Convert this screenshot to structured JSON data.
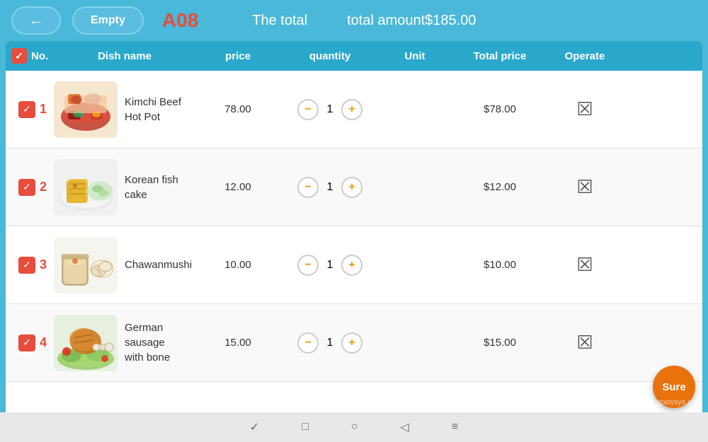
{
  "header": {
    "back_label": "←",
    "empty_label": "Empty",
    "table_id": "A08",
    "total_label": "The total",
    "total_amount": "total amount$185.00"
  },
  "table": {
    "columns": [
      "No.",
      "Dish name",
      "price",
      "quantity",
      "Unit",
      "Total price",
      "Operate"
    ],
    "rows": [
      {
        "id": 1,
        "name": "Kimchi Beef Hot Pot",
        "price": "78.00",
        "quantity": 1,
        "unit": "",
        "total_price": "$78.00",
        "color_scheme": "red-broth"
      },
      {
        "id": 2,
        "name": "Korean fish cake",
        "price": "12.00",
        "quantity": 1,
        "unit": "",
        "total_price": "$12.00",
        "color_scheme": "fish-cake"
      },
      {
        "id": 3,
        "name": "Chawanmushi",
        "price": "10.00",
        "quantity": 1,
        "unit": "",
        "total_price": "$10.00",
        "color_scheme": "chawanmushi"
      },
      {
        "id": 4,
        "name": "German sausage\nwith bone",
        "price": "15.00",
        "quantity": 1,
        "unit": "",
        "total_price": "$15.00",
        "color_scheme": "sausage"
      }
    ]
  },
  "sure_button": "Sure",
  "bottom_nav": [
    "✓",
    "□",
    "○",
    "◁",
    "≡"
  ],
  "watermark": "de.gpossys.com"
}
